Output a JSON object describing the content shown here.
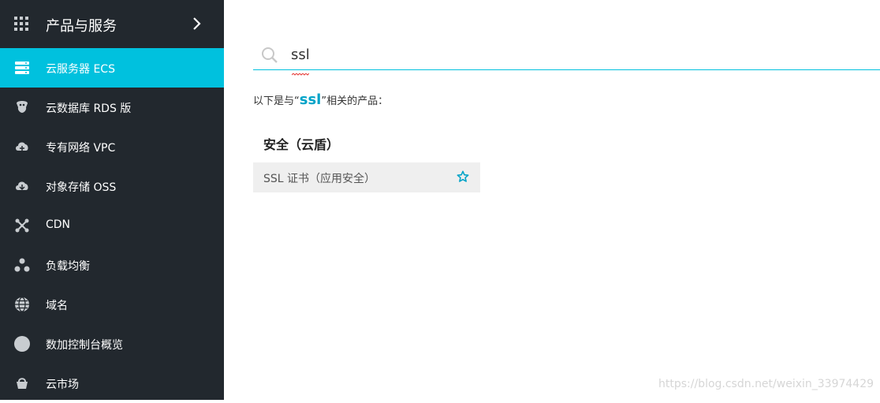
{
  "sidebar": {
    "header": {
      "label": "产品与服务",
      "icon": "grid-icon",
      "chevron": "chevron-right-icon"
    },
    "items": [
      {
        "label": "云服务器 ECS",
        "icon": "server-icon",
        "active": true
      },
      {
        "label": "云数据库 RDS 版",
        "icon": "database-icon"
      },
      {
        "label": "专有网络 VPC",
        "icon": "cloud-network-icon"
      },
      {
        "label": "对象存储 OSS",
        "icon": "cloud-storage-icon"
      },
      {
        "label": "CDN",
        "icon": "cdn-icon"
      },
      {
        "label": "负载均衡",
        "icon": "load-balancer-icon"
      },
      {
        "label": "域名",
        "icon": "globe-icon"
      },
      {
        "label": "数加控制台概览",
        "icon": "circle-icon"
      },
      {
        "label": "云市场",
        "icon": "market-icon"
      }
    ]
  },
  "search": {
    "value": "ssl",
    "icon": "search-icon"
  },
  "results": {
    "prefix": "以下是与“",
    "keyword": "ssl",
    "suffix": "”相关的产品：",
    "category": "安全（云盾）",
    "product": {
      "label": "SSL 证书（应用安全）",
      "icon": "star-outline-icon"
    }
  },
  "colors": {
    "sidebar_bg": "#22282e",
    "accent": "#00c1de"
  },
  "watermark": "https://blog.csdn.net/weixin_33974429"
}
